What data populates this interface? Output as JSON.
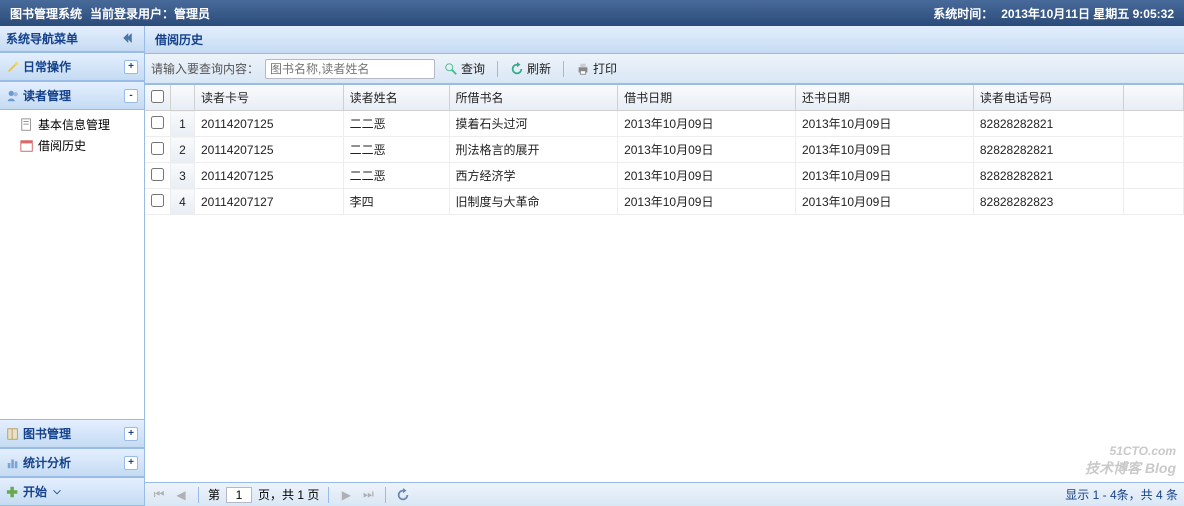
{
  "header": {
    "app_title": "图书管理系统",
    "user_prefix": "当前登录用户：",
    "user": "管理员",
    "systime_label": "系统时间：",
    "systime_value": "2013年10月11日 星期五 9:05:32"
  },
  "sidebar": {
    "title": "系统导航菜单",
    "panels": [
      {
        "label": "日常操作",
        "state": "+"
      },
      {
        "label": "读者管理",
        "state": "-"
      },
      {
        "label": "图书管理",
        "state": "+"
      },
      {
        "label": "统计分析",
        "state": "+"
      },
      {
        "label": "开始",
        "state": ""
      }
    ],
    "tree": [
      {
        "label": "基本信息管理"
      },
      {
        "label": "借阅历史"
      }
    ]
  },
  "content": {
    "title": "借阅历史"
  },
  "toolbar": {
    "prompt": "请输入要查询内容：",
    "placeholder": "图书名称,读者姓名",
    "search": "查询",
    "refresh": "刷新",
    "print": "打印"
  },
  "table": {
    "columns": [
      "读者卡号",
      "读者姓名",
      "所借书名",
      "借书日期",
      "还书日期",
      "读者电话号码"
    ],
    "rows": [
      {
        "idx": "1",
        "card": "20114207125",
        "name": "二二恶",
        "book": "摸着石头过河",
        "borrow": "2013年10月09日",
        "return": "2013年10月09日",
        "phone": "82828282821"
      },
      {
        "idx": "2",
        "card": "20114207125",
        "name": "二二恶",
        "book": "刑法格言的展开",
        "borrow": "2013年10月09日",
        "return": "2013年10月09日",
        "phone": "82828282821"
      },
      {
        "idx": "3",
        "card": "20114207125",
        "name": "二二恶",
        "book": "西方经济学",
        "borrow": "2013年10月09日",
        "return": "2013年10月09日",
        "phone": "82828282821"
      },
      {
        "idx": "4",
        "card": "20114207127",
        "name": "李四",
        "book": "旧制度与大革命",
        "borrow": "2013年10月09日",
        "return": "2013年10月09日",
        "phone": "82828282823"
      }
    ]
  },
  "paging": {
    "page_label_prefix": "第",
    "page_value": "1",
    "page_label_suffix": "页，共 1 页",
    "info": "显示 1 - 4条，共 4 条"
  },
  "watermark": {
    "main": "51CTO.com",
    "sub": "技术博客 Blog"
  }
}
